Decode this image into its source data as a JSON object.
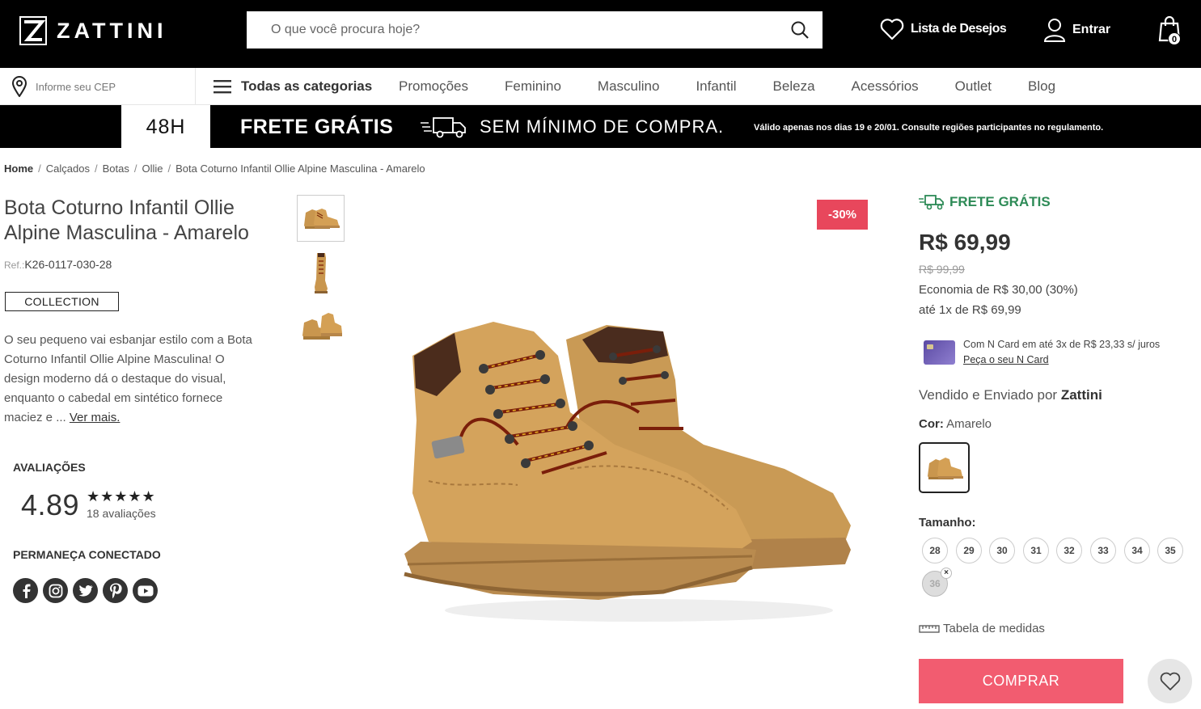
{
  "header": {
    "logo_text": "ZATTINI",
    "search_placeholder": "O que você procura hoje?",
    "wishlist_label": "Lista de Desejos",
    "login_label": "Entrar",
    "cart_count": "0"
  },
  "nav": {
    "cep_placeholder": "Informe seu CEP",
    "all_categories": "Todas as categorias",
    "links": [
      "Promoções",
      "Feminino",
      "Masculino",
      "Infantil",
      "Beleza",
      "Acessórios",
      "Outlet",
      "Blog"
    ]
  },
  "promo": {
    "badge": "48H",
    "headline": "FRETE GRÁTIS",
    "subline": "SEM MÍNIMO DE COMPRA.",
    "note": "Válido apenas nos dias 19 e 20/01. Consulte regiões participantes no regulamento."
  },
  "breadcrumb": [
    "Home",
    "Calçados",
    "Botas",
    "Ollie",
    "Bota Coturno Infantil Ollie Alpine Masculina - Amarelo"
  ],
  "product": {
    "title": "Bota Coturno Infantil Ollie Alpine Masculina - Amarelo",
    "ref_label": "Ref.:",
    "ref_value": "K26-0117-030-28",
    "collection": "COLLECTION",
    "description": "O seu pequeno vai esbanjar estilo com a Bota Coturno Infantil Ollie Alpine Masculina! O design moderno dá o destaque do visual, enquanto o cabedal em sintético fornece maciez e ...",
    "see_more": "Ver mais.",
    "discount": "-30%",
    "free_shipping": "FRETE GRÁTIS",
    "price": "R$ 69,99",
    "old_price": "R$ 99,99",
    "economy": "Economia de R$ 30,00 (30%)",
    "installments": "até 1x de R$ 69,99",
    "ncard_text": "Com N Card em até 3x de R$ 23,33 s/ juros",
    "ncard_link": "Peça o seu N Card",
    "seller_prefix": "Vendido e Enviado por",
    "seller_name": "Zattini",
    "color_label": "Cor:",
    "color_value": "Amarelo",
    "size_label": "Tamanho:",
    "sizes": [
      "28",
      "29",
      "30",
      "31",
      "32",
      "33",
      "34",
      "35",
      "36"
    ],
    "unavailable_size": "36",
    "size_chart": "Tabela de medidas",
    "buy_label": "COMPRAR"
  },
  "reviews": {
    "heading": "AVALIAÇÕES",
    "score": "4.89",
    "stars": "★★★★★",
    "count": "18 avaliações",
    "rating_fraction": 0.978
  },
  "social": {
    "heading": "PERMANEÇA CONECTADO",
    "icons": [
      "facebook-icon",
      "instagram-icon",
      "twitter-icon",
      "pinterest-icon",
      "youtube-icon"
    ]
  },
  "colors": {
    "accent": "#f25c70",
    "discount": "#e8475c",
    "free_shipping": "#2e8b57",
    "header_bg": "#000000"
  }
}
